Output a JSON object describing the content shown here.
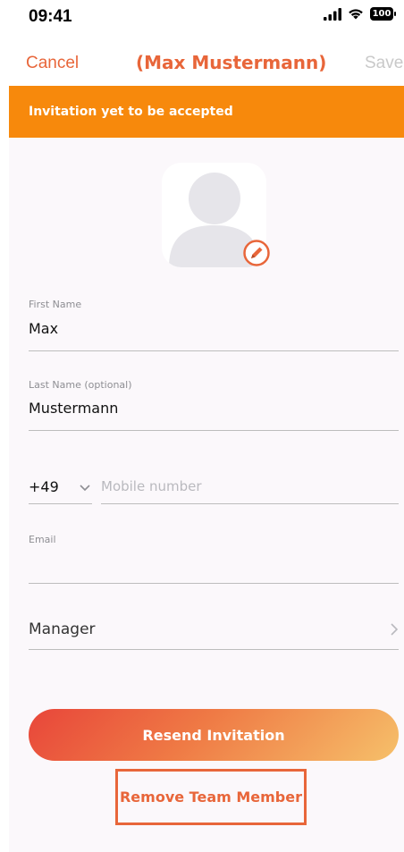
{
  "status_bar": {
    "time": "09:41",
    "battery": "100"
  },
  "nav": {
    "cancel": "Cancel",
    "title": "(Max Mustermann)",
    "save": "Save"
  },
  "banner": {
    "text": "Invitation yet to be accepted"
  },
  "form": {
    "first_name": {
      "label": "First Name",
      "value": "Max"
    },
    "last_name": {
      "label": "Last Name (optional)",
      "value": "Mustermann"
    },
    "phone": {
      "country_code": "+49",
      "placeholder": "Mobile number"
    },
    "email": {
      "label": "Email",
      "value": ""
    },
    "role": {
      "value": "Manager"
    }
  },
  "actions": {
    "resend": "Resend Invitation",
    "remove": "Remove Team Member"
  },
  "colors": {
    "accent": "#e8663a",
    "banner": "#f7890c",
    "save_disabled": "#c9c9c9"
  },
  "icons": [
    "signal-icon",
    "wifi-icon",
    "battery-icon",
    "avatar-placeholder-icon",
    "edit-pencil-icon",
    "chevron-down-icon",
    "chevron-right-icon"
  ]
}
